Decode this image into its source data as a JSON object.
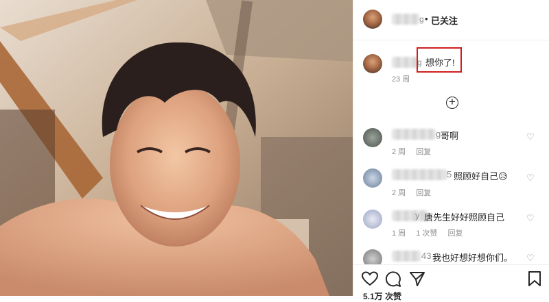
{
  "header": {
    "username_tail": "g",
    "separator": "•",
    "follow_label": "已关注"
  },
  "caption": {
    "username_tail": "g",
    "text": "想你了!",
    "time": "23 周"
  },
  "more_comments": {
    "icon": "plus-circle-icon"
  },
  "comments": [
    {
      "username_tail": "g",
      "text": "哥啊",
      "time": "2 周",
      "reply": "回复",
      "likes": ""
    },
    {
      "username_tail": "5",
      "text": "照顾好自己😥",
      "time": "2 周",
      "reply": "回复",
      "likes": ""
    },
    {
      "username_tail": "y",
      "text": "唐先生好好照顾自己",
      "time": "1 周",
      "reply": "回复",
      "likes": "1 次赞"
    },
    {
      "username_tail": "43",
      "text": "我也好想好想你们。",
      "time": "",
      "reply": "",
      "likes": ""
    }
  ],
  "actions": {
    "like": "heart-outline-icon",
    "comment": "comment-icon",
    "share": "paper-plane-icon",
    "save": "bookmark-icon"
  },
  "likes_count": "5.1万 次赞",
  "colors": {
    "highlight_box": "#d11d1d",
    "muted": "#8e8e8e"
  }
}
